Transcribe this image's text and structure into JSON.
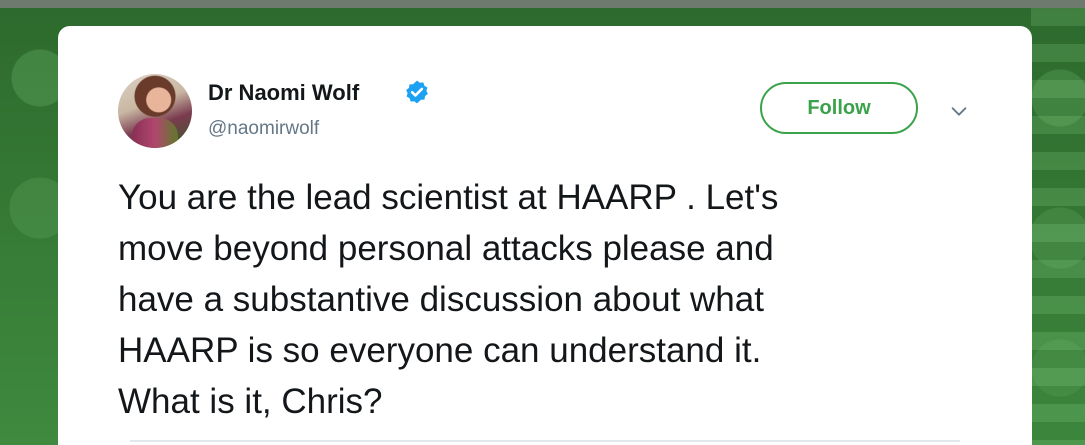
{
  "tweet": {
    "author_name": "Dr Naomi Wolf",
    "author_handle": "@naomirwolf",
    "verified": true,
    "follow_label": "Follow",
    "text": "You are the lead scientist at HAARP . Let's\nmove beyond personal attacks please and\nhave a substantive discussion about what\nHAARP is so everyone can understand it.\nWhat is it, Chris?"
  },
  "icons": {
    "verified": "verified-badge-icon",
    "menu": "chevron-down-icon"
  },
  "colors": {
    "accent_green": "#3aa24a",
    "verified_blue": "#1da1f2",
    "text_primary": "#14171a",
    "text_secondary": "#657786",
    "background_green": "#2f6b2f"
  }
}
